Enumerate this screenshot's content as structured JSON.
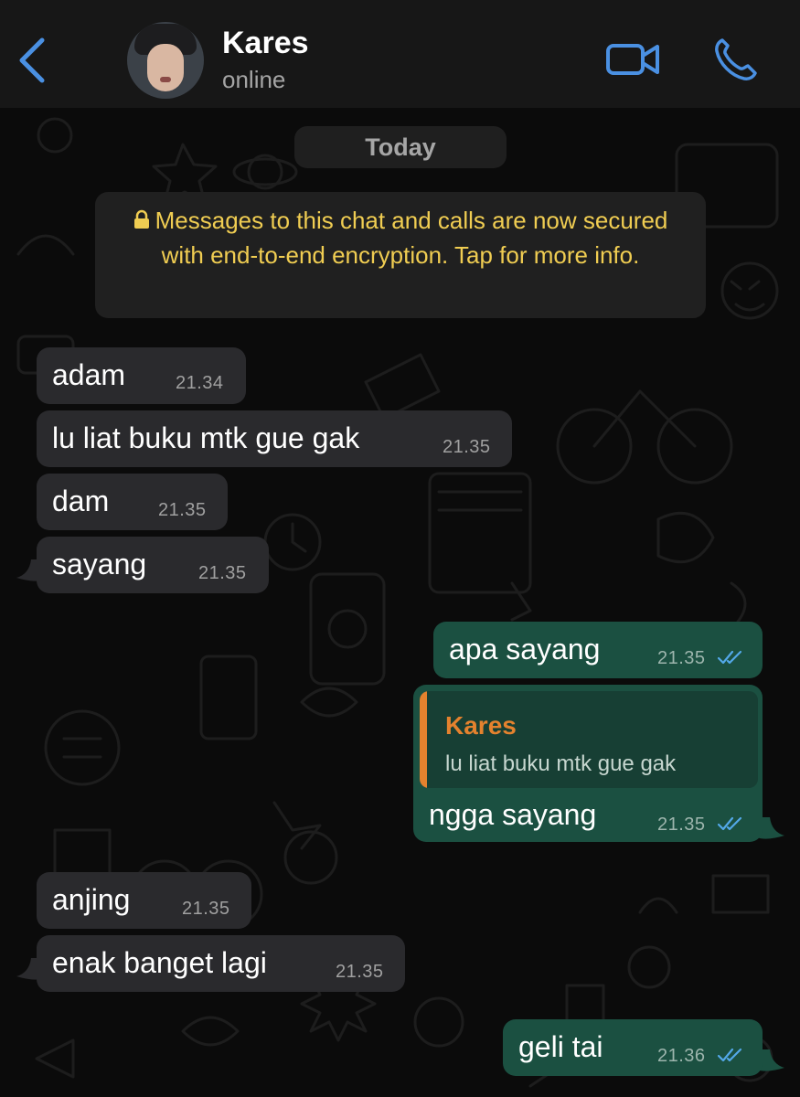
{
  "header": {
    "contact_name": "Kares",
    "status": "online",
    "icons": {
      "back": "chevron-left-icon",
      "video": "video-camera-icon",
      "call": "phone-icon"
    },
    "accent_color": "#4a90e2"
  },
  "chat": {
    "date_label": "Today",
    "encryption_notice": "Messages to this chat and calls are now secured with end-to-end encryption. Tap for more info.",
    "encryption_icon": "lock-icon",
    "notice_color": "#f0cd52",
    "messages": [
      {
        "direction": "incoming",
        "text": "adam",
        "time": "21.34"
      },
      {
        "direction": "incoming",
        "text": "lu liat buku mtk gue gak",
        "time": "21.35"
      },
      {
        "direction": "incoming",
        "text": "dam",
        "time": "21.35"
      },
      {
        "direction": "incoming",
        "text": "sayang",
        "time": "21.35"
      },
      {
        "direction": "outgoing",
        "text": "apa sayang",
        "time": "21.35",
        "read": true
      },
      {
        "direction": "outgoing",
        "text": "ngga sayang",
        "time": "21.35",
        "read": true,
        "reply_to": {
          "author": "Kares",
          "text": "lu liat buku mtk gue gak"
        }
      },
      {
        "direction": "incoming",
        "text": "anjing",
        "time": "21.35"
      },
      {
        "direction": "incoming",
        "text": "enak banget lagi",
        "time": "21.35"
      },
      {
        "direction": "outgoing",
        "text": "geli tai",
        "time": "21.36",
        "read": true
      }
    ]
  },
  "colors": {
    "incoming_bubble": "#2a2a2d",
    "outgoing_bubble": "#1b5041",
    "reply_author": "#e4822e",
    "read_ticks": "#53a8e8"
  }
}
